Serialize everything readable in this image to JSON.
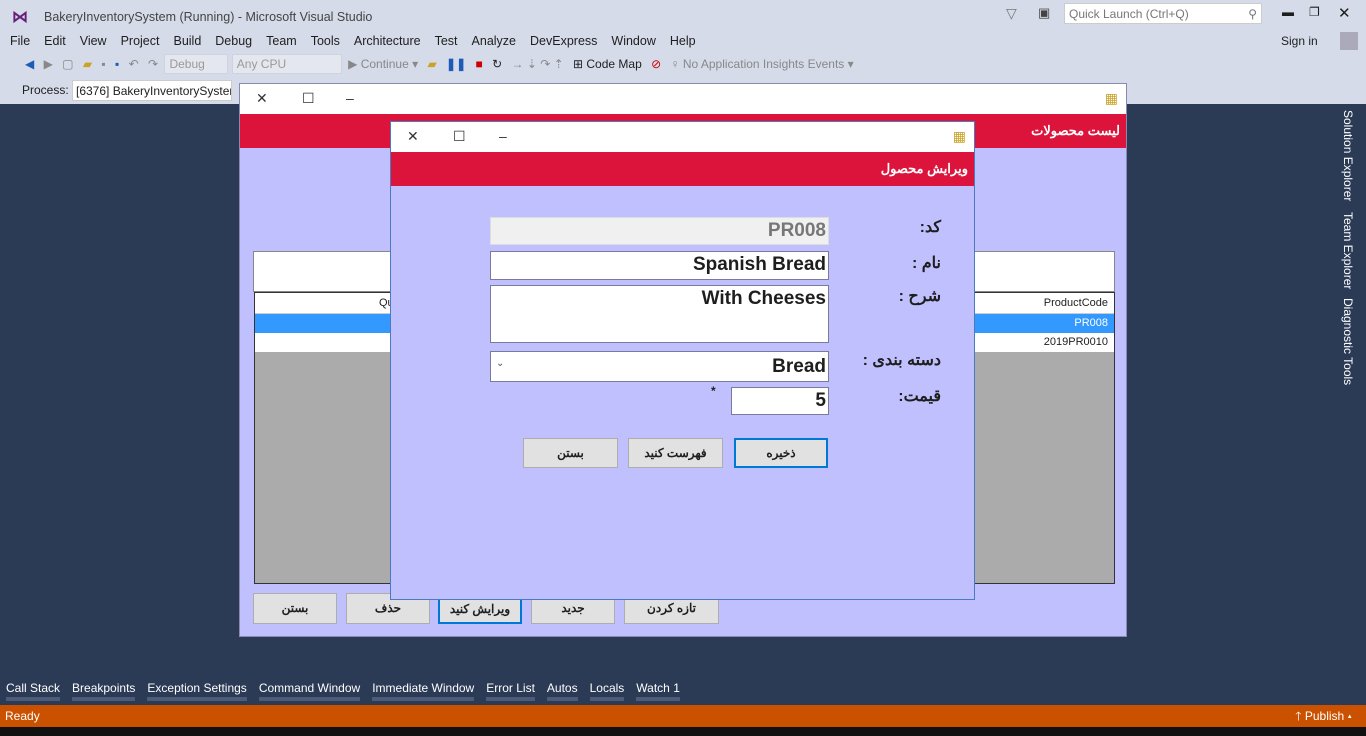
{
  "ide": {
    "title": "BakeryInventorySystem (Running) - Microsoft Visual Studio",
    "quick_launch": "Quick Launch (Ctrl+Q)",
    "sign_in": "Sign in",
    "menu": [
      "File",
      "Edit",
      "View",
      "Project",
      "Build",
      "Debug",
      "Team",
      "Tools",
      "Architecture",
      "Test",
      "Analyze",
      "DevExpress",
      "Window",
      "Help"
    ],
    "toolbar": {
      "config": "Debug",
      "platform": "Any CPU",
      "continue": "Continue",
      "code_map": "Code Map",
      "insights": "No Application Insights Events"
    },
    "process_label": "Process:",
    "process_value": "[6376] BakeryInventorySystem",
    "right_tabs": [
      "Solution Explorer",
      "Team Explorer",
      "Diagnostic Tools"
    ],
    "bottom_tabs": [
      "Call Stack",
      "Breakpoints",
      "Exception Settings",
      "Command Window",
      "Immediate Window",
      "Error List",
      "Autos",
      "Locals",
      "Watch 1"
    ],
    "status": "Ready",
    "publish": "Publish"
  },
  "list_form": {
    "header": "لیست محصولات",
    "columns": [
      "ProductCode",
      "Qu"
    ],
    "rows": [
      "PR008",
      "2019PR0010"
    ],
    "buttons": [
      "تازه کردن",
      "جدید",
      "ویرایش کنید",
      "حذف",
      "بستن"
    ]
  },
  "edit_form": {
    "header": "ویرایش محصول",
    "labels": {
      "code": "کد:",
      "name": "نام :",
      "desc": "شرح :",
      "category": "دسته بندی :",
      "price": "قیمت:"
    },
    "values": {
      "code": "PR008",
      "name": "Spanish Bread",
      "desc": "With Cheeses",
      "category": "Bread",
      "price": "5"
    },
    "required_mark": "*",
    "buttons": {
      "save": "ذخیره",
      "list": "فهرست کنید",
      "close": "بستن"
    }
  },
  "colors": {
    "header_red": "#dc143c",
    "form_bg": "#c0c0ff",
    "status": "#ca5100",
    "selection": "#3399ff"
  }
}
